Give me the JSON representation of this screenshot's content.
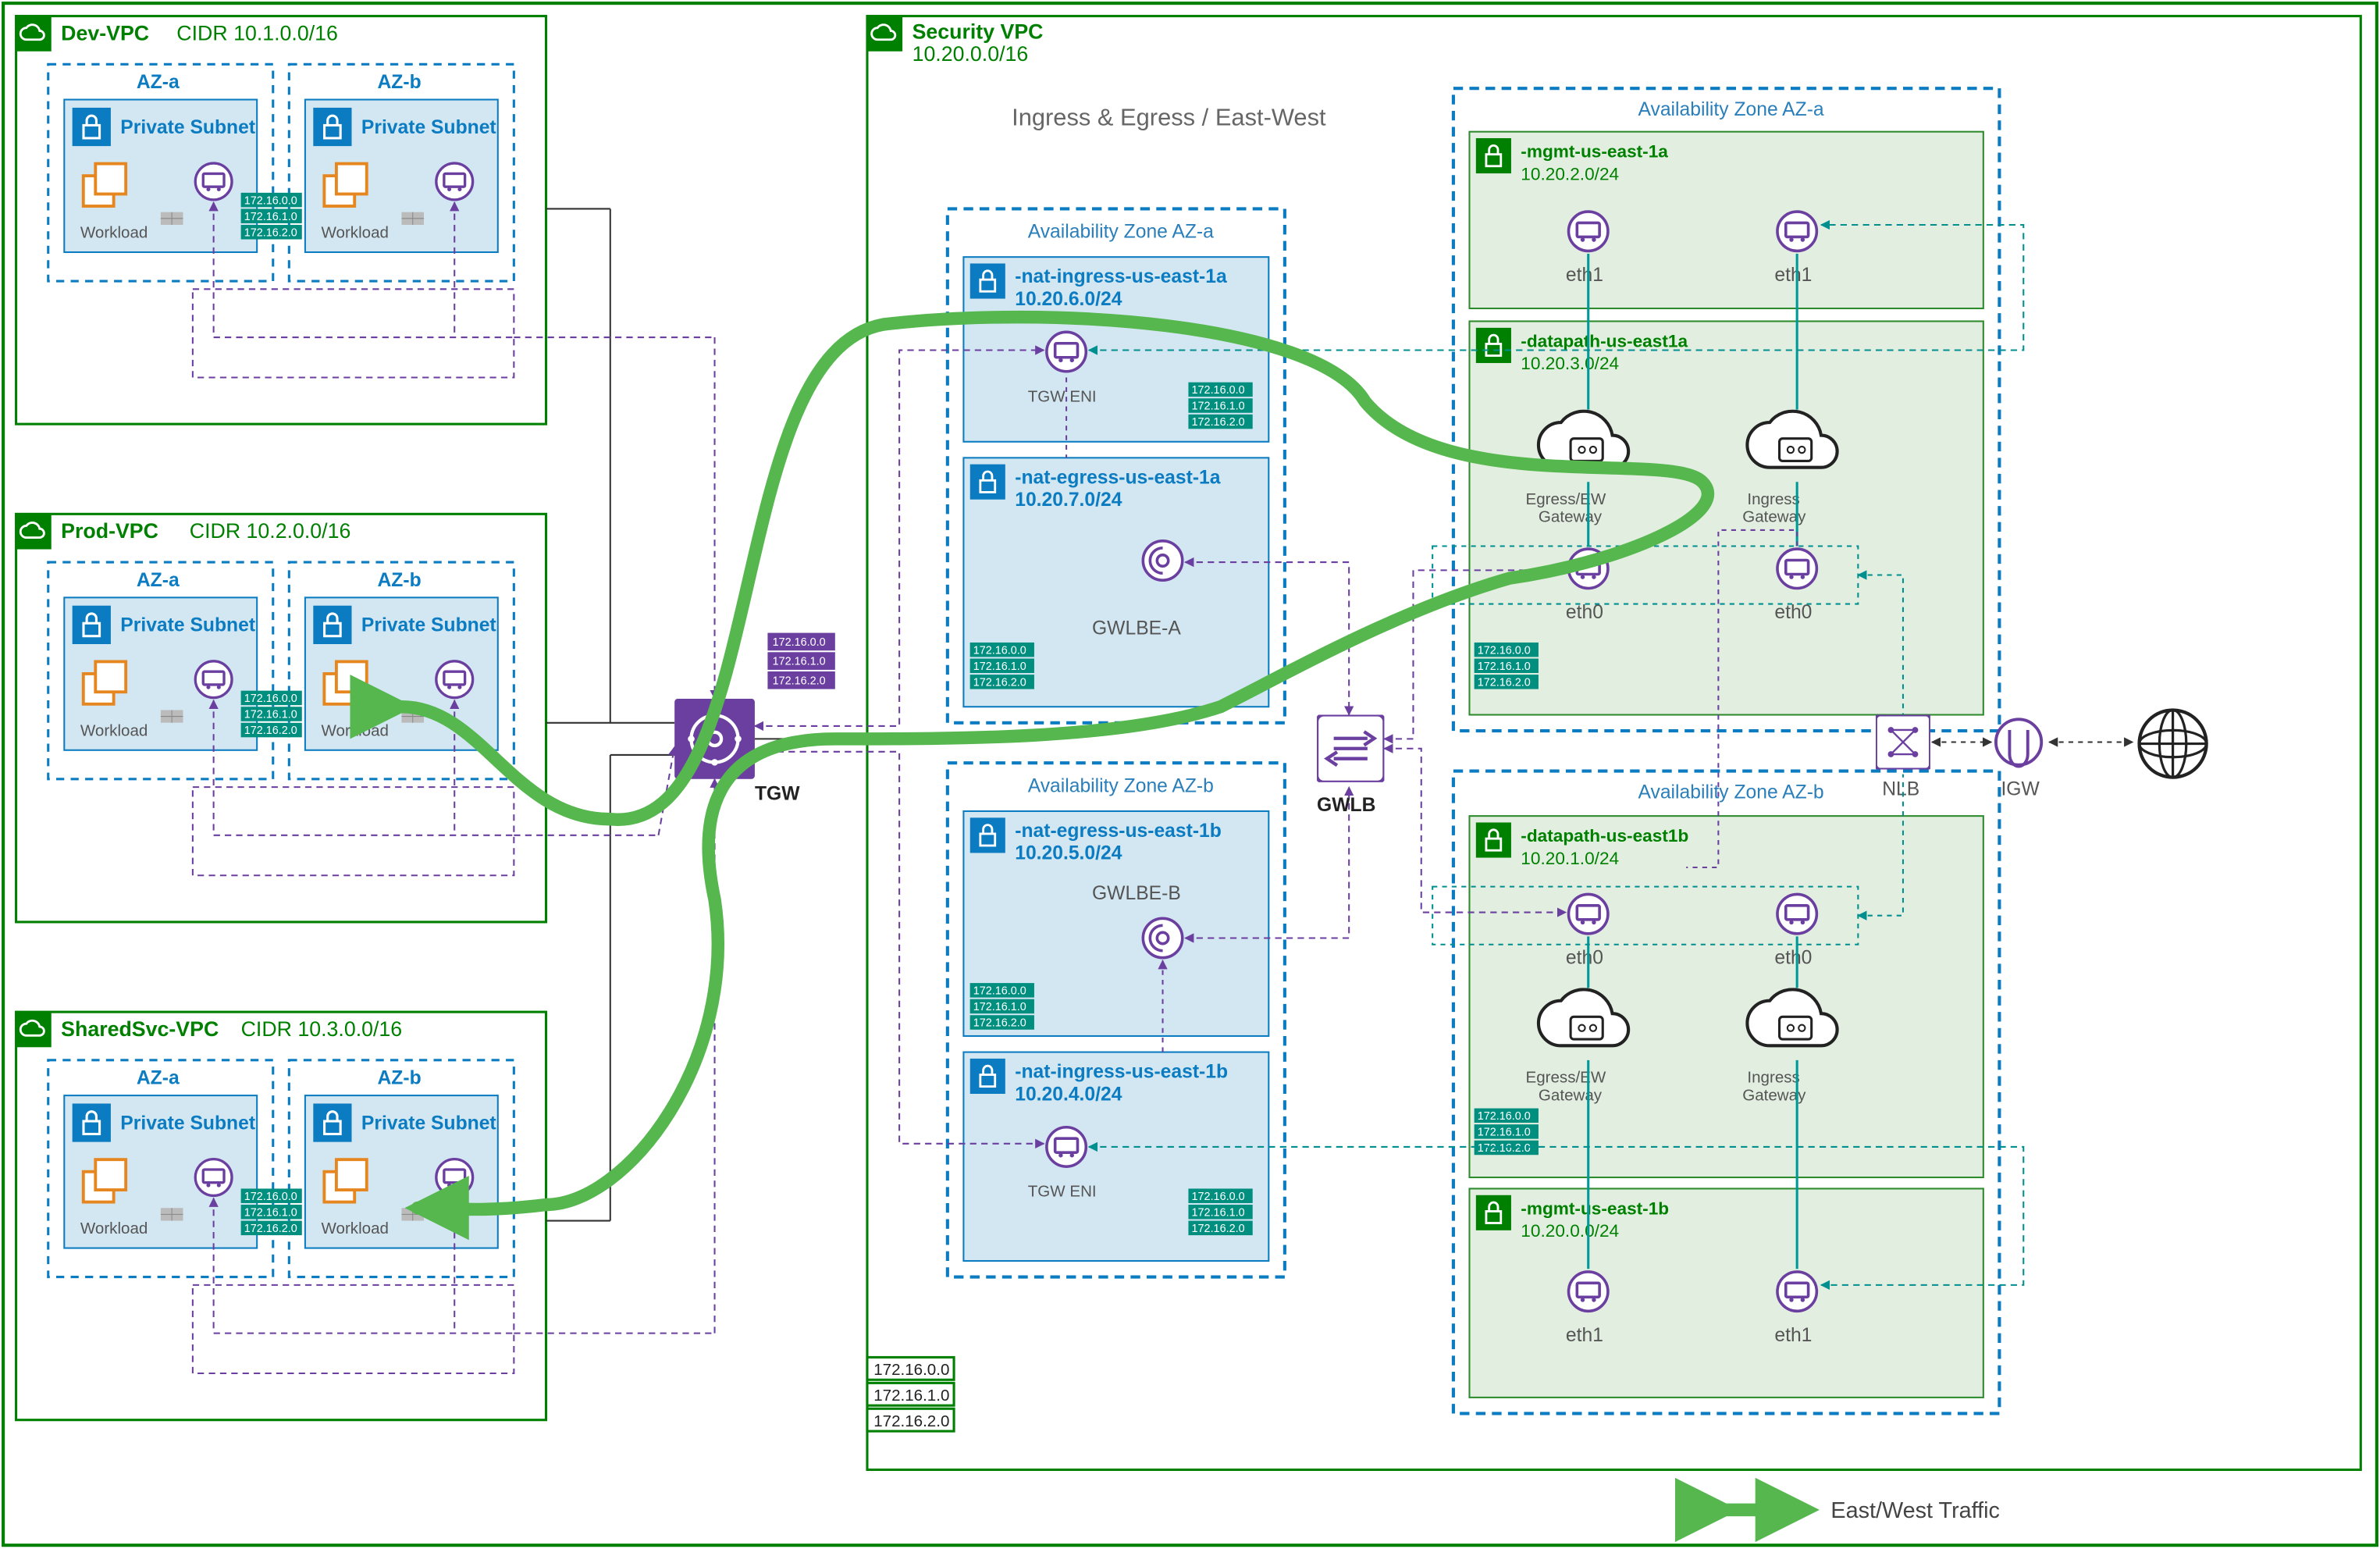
{
  "spoke_vpcs": [
    {
      "name": "Dev-VPC",
      "cidr": "CIDR 10.1.0.0/16"
    },
    {
      "name": "Prod-VPC",
      "cidr": "CIDR 10.2.0.0/16"
    },
    {
      "name": "SharedSvc-VPC",
      "cidr": "CIDR 10.3.0.0/16"
    }
  ],
  "spoke_az": [
    "AZ-a",
    "AZ-b"
  ],
  "private_subnet": "Private Subnet",
  "workload": "Workload",
  "routes": [
    "172.16.0.0",
    "172.16.1.0",
    "172.16.2.0"
  ],
  "tgw": "TGW",
  "sec_vpc": {
    "name": "Security VPC",
    "cidr": "10.20.0.0/16"
  },
  "center_title": "Ingress & Egress / East-West",
  "sec_az_a": "Availability Zone AZ-a",
  "sec_az_b": "Availability Zone AZ-b",
  "nat_ingress_a": {
    "name": "-nat-ingress-us-east-1a",
    "cidr": "10.20.6.0/24"
  },
  "nat_egress_a": {
    "name": "-nat-egress-us-east-1a",
    "cidr": "10.20.7.0/24"
  },
  "nat_egress_b": {
    "name": "-nat-egress-us-east-1b",
    "cidr": "10.20.5.0/24"
  },
  "nat_ingress_b": {
    "name": "-nat-ingress-us-east-1b",
    "cidr": "10.20.4.0/24"
  },
  "gwlbe_a": "GWLBE-A",
  "gwlbe_b": "GWLBE-B",
  "tgw_eni": "TGW ENI",
  "gwlb": "GWLB",
  "right_az_a": "Availability Zone AZ-a",
  "right_az_b": "Availability Zone AZ-b",
  "mgmt_a": {
    "name": "-mgmt-us-east-1a",
    "cidr": "10.20.2.0/24"
  },
  "datapath_a": {
    "name": "-datapath-us-east1a",
    "cidr": "10.20.3.0/24"
  },
  "datapath_b": {
    "name": "-datapath-us-east1b",
    "cidr": "10.20.1.0/24"
  },
  "mgmt_b": {
    "name": "-mgmt-us-east-1b",
    "cidr": "10.20.0.0/24"
  },
  "eth0": "eth0",
  "eth1": "eth1",
  "egress_gw": "Egress/EW\nGateway",
  "ingress_gw": "Ingress\nGateway",
  "nlb": "NLB",
  "igw": "IGW",
  "legend": "East/West Traffic"
}
